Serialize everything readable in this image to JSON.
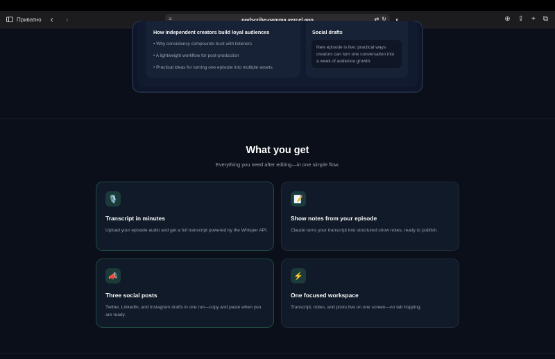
{
  "browser": {
    "sidebar_label": "Приватно",
    "url": "podscribe-gamma.vercel.app",
    "back_icon": "chevron-left-icon",
    "forward_icon": "chevron-right-icon"
  },
  "preview": {
    "post_title": "How independent creators build loyal audiences",
    "bullets": [
      "• Why consistency compounds trust with listeners",
      "• A lightweight workflow for post-production",
      "• Practical ideas for turning one episode into multiple assets"
    ],
    "social_title": "Social drafts",
    "social_text": "New episode is live: practical ways creators can turn one conversation into a week of audience growth."
  },
  "features": {
    "title": "What you get",
    "subtitle": "Everything you need after editing—in one simple flow.",
    "cards": [
      {
        "icon": "🎙️",
        "icon_name": "microphone-icon",
        "title": "Transcript in minutes",
        "desc": "Upload your episode audio and get a full transcript powered by the Whisper API."
      },
      {
        "icon": "📝",
        "icon_name": "memo-icon",
        "title": "Show notes from your episode",
        "desc": "Claude turns your transcript into structured show notes, ready to publish."
      },
      {
        "icon": "📣",
        "icon_name": "megaphone-icon",
        "title": "Three social posts",
        "desc": "Twitter, LinkedIn, and Instagram drafts in one run—copy and paste when you are ready."
      },
      {
        "icon": "⚡",
        "icon_name": "lightning-icon",
        "title": "One focused workspace",
        "desc": "Transcript, notes, and posts live on one screen—no tab hopping."
      }
    ]
  }
}
